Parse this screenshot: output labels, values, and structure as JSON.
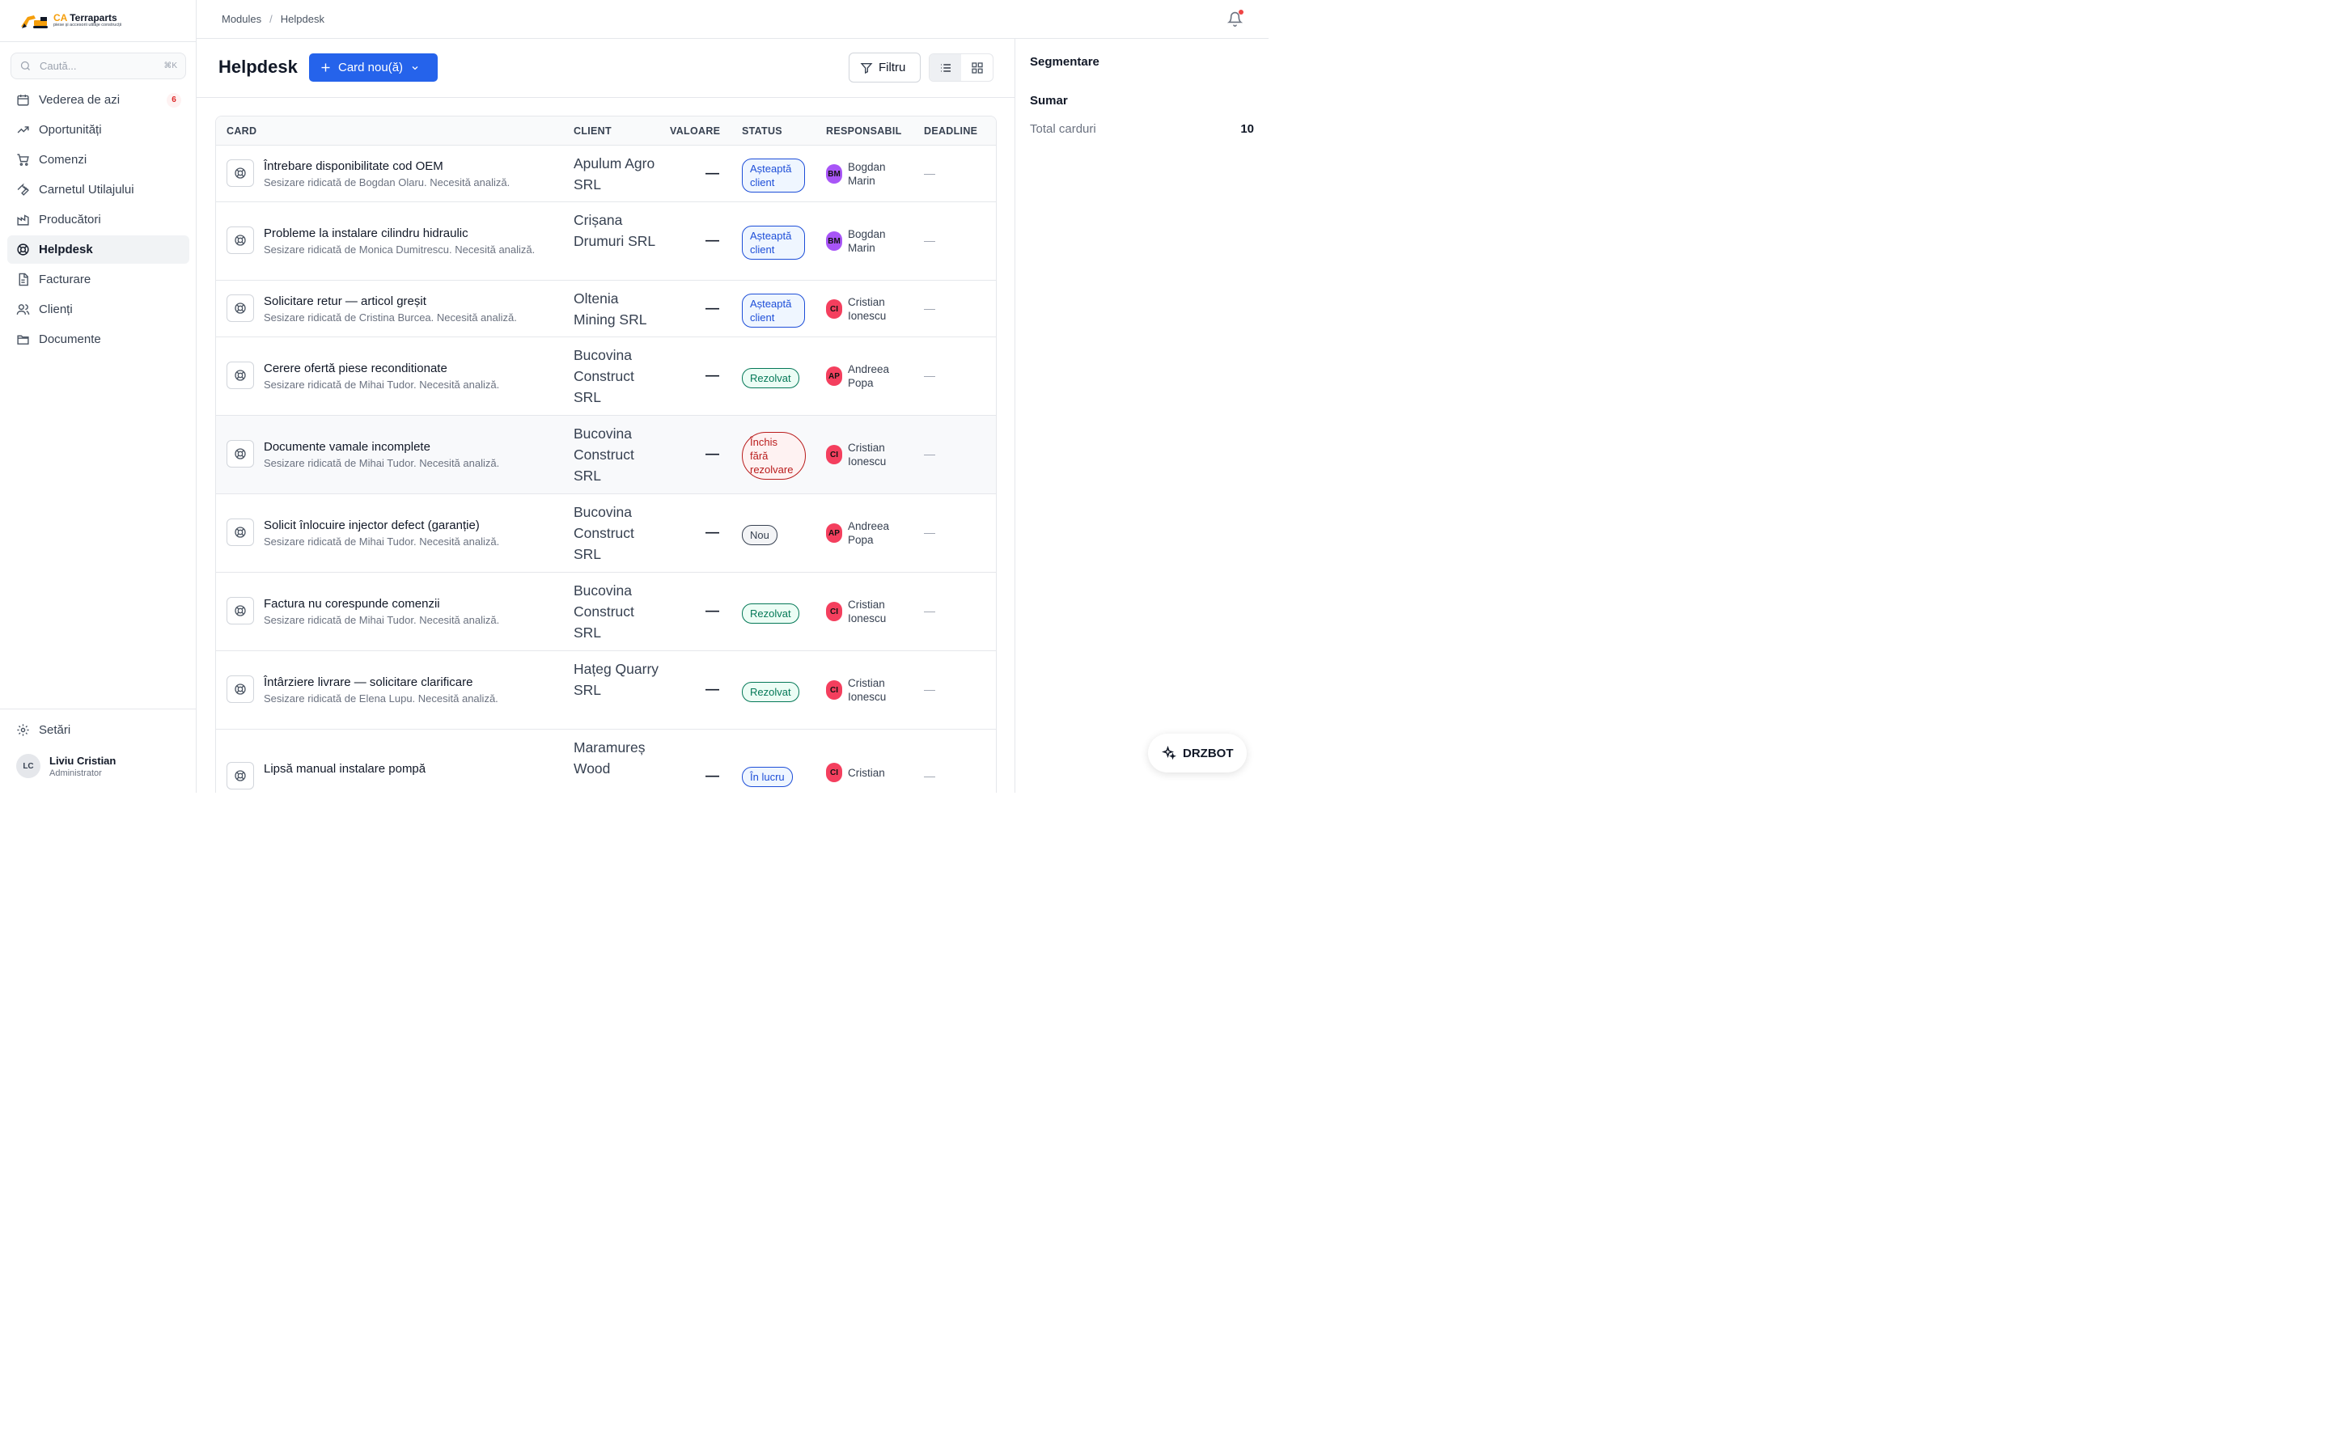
{
  "brand": {
    "prefix": "CA",
    "name": " Terraparts",
    "tagline": "piese și accesorii utilaje construcții"
  },
  "search": {
    "placeholder": "Caută...",
    "shortcut": "⌘K"
  },
  "sidebar": {
    "items": [
      {
        "label": "Vederea de azi",
        "icon": "calendar-icon",
        "badge": "6"
      },
      {
        "label": "Oportunități",
        "icon": "trending-up-icon"
      },
      {
        "label": "Comenzi",
        "icon": "cart-icon"
      },
      {
        "label": "Carnetul Utilajului",
        "icon": "wrench-icon"
      },
      {
        "label": "Producători",
        "icon": "factory-icon"
      },
      {
        "label": "Helpdesk",
        "icon": "lifebuoy-icon",
        "active": true
      },
      {
        "label": "Facturare",
        "icon": "invoice-icon"
      },
      {
        "label": "Clienți",
        "icon": "users-icon"
      },
      {
        "label": "Documente",
        "icon": "folder-icon"
      }
    ],
    "settings_label": "Setări",
    "user": {
      "initials": "LC",
      "name": "Liviu Cristian",
      "role": "Administrator"
    }
  },
  "breadcrumb": [
    "Modules",
    "Helpdesk"
  ],
  "page": {
    "title": "Helpdesk",
    "new_button": "Card nou(ă)",
    "filter_button": "Filtru"
  },
  "table": {
    "headers": {
      "card": "CARD",
      "client": "CLIENT",
      "value": "VALOARE",
      "status": "STATUS",
      "owner": "RESPONSABIL",
      "deadline": "DEADLINE"
    },
    "rows": [
      {
        "title": "Întrebare disponibilitate cod OEM",
        "sub": "Sesizare ridicată de Bogdan Olaru. Necesită analiză.",
        "client": "Apulum Agro SRL",
        "value": "—",
        "status": "Așteaptă client",
        "status_kind": "wait",
        "owner_initials": "BM",
        "owner": "Bogdan Marin",
        "deadline": "—"
      },
      {
        "title": "Probleme la instalare cilindru hidraulic",
        "sub": "Sesizare ridicată de Monica Dumitrescu. Necesită analiză.",
        "client": "Crișana Drumuri SRL",
        "value": "—",
        "status": "Așteaptă client",
        "status_kind": "wait",
        "owner_initials": "BM",
        "owner": "Bogdan Marin",
        "deadline": "—"
      },
      {
        "title": "Solicitare retur — articol greșit",
        "sub": "Sesizare ridicată de Cristina Burcea. Necesită analiză.",
        "client": "Oltenia Mining SRL",
        "value": "—",
        "status": "Așteaptă client",
        "status_kind": "wait",
        "owner_initials": "CI",
        "owner": "Cristian Ionescu",
        "deadline": "—"
      },
      {
        "title": "Cerere ofertă piese reconditionate",
        "sub": "Sesizare ridicată de Mihai Tudor. Necesită analiză.",
        "client": "Bucovina Construct SRL",
        "value": "—",
        "status": "Rezolvat",
        "status_kind": "done",
        "owner_initials": "AP",
        "owner": "Andreea Popa",
        "deadline": "—"
      },
      {
        "title": "Documente vamale incomplete",
        "sub": "Sesizare ridicată de Mihai Tudor. Necesită analiză.",
        "client": "Bucovina Construct SRL",
        "value": "—",
        "status": "Închis fără rezolvare",
        "status_kind": "closed",
        "owner_initials": "CI",
        "owner": "Cristian Ionescu",
        "deadline": "—"
      },
      {
        "title": "Solicit înlocuire injector defect (garanție)",
        "sub": "Sesizare ridicată de Mihai Tudor. Necesită analiză.",
        "client": "Bucovina Construct SRL",
        "value": "—",
        "status": "Nou",
        "status_kind": "new",
        "owner_initials": "AP",
        "owner": "Andreea Popa",
        "deadline": "—"
      },
      {
        "title": "Factura nu corespunde comenzii",
        "sub": "Sesizare ridicată de Mihai Tudor. Necesită analiză.",
        "client": "Bucovina Construct SRL",
        "value": "—",
        "status": "Rezolvat",
        "status_kind": "done",
        "owner_initials": "CI",
        "owner": "Cristian Ionescu",
        "deadline": "—"
      },
      {
        "title": "Întârziere livrare — solicitare clarificare",
        "sub": "Sesizare ridicată de Elena Lupu. Necesită analiză.",
        "client": "Hațeg Quarry SRL",
        "value": "—",
        "status": "Rezolvat",
        "status_kind": "done",
        "owner_initials": "CI",
        "owner": "Cristian Ionescu",
        "deadline": "—"
      },
      {
        "title": "Lipsă manual instalare pompă",
        "sub": "",
        "client": "Maramureș Wood",
        "value": "—",
        "status": "În lucru",
        "status_kind": "work",
        "owner_initials": "CI",
        "owner": "Cristian",
        "deadline": "—"
      }
    ]
  },
  "right_panel": {
    "segment_title": "Segmentare",
    "summary_title": "Sumar",
    "total_label": "Total carduri",
    "total_value": "10"
  },
  "assistant": {
    "label": "DRZBOT"
  },
  "colors": {
    "accent": "#2563eb",
    "badge_red": "#dc2626",
    "logo_orange": "#f59e0b"
  }
}
